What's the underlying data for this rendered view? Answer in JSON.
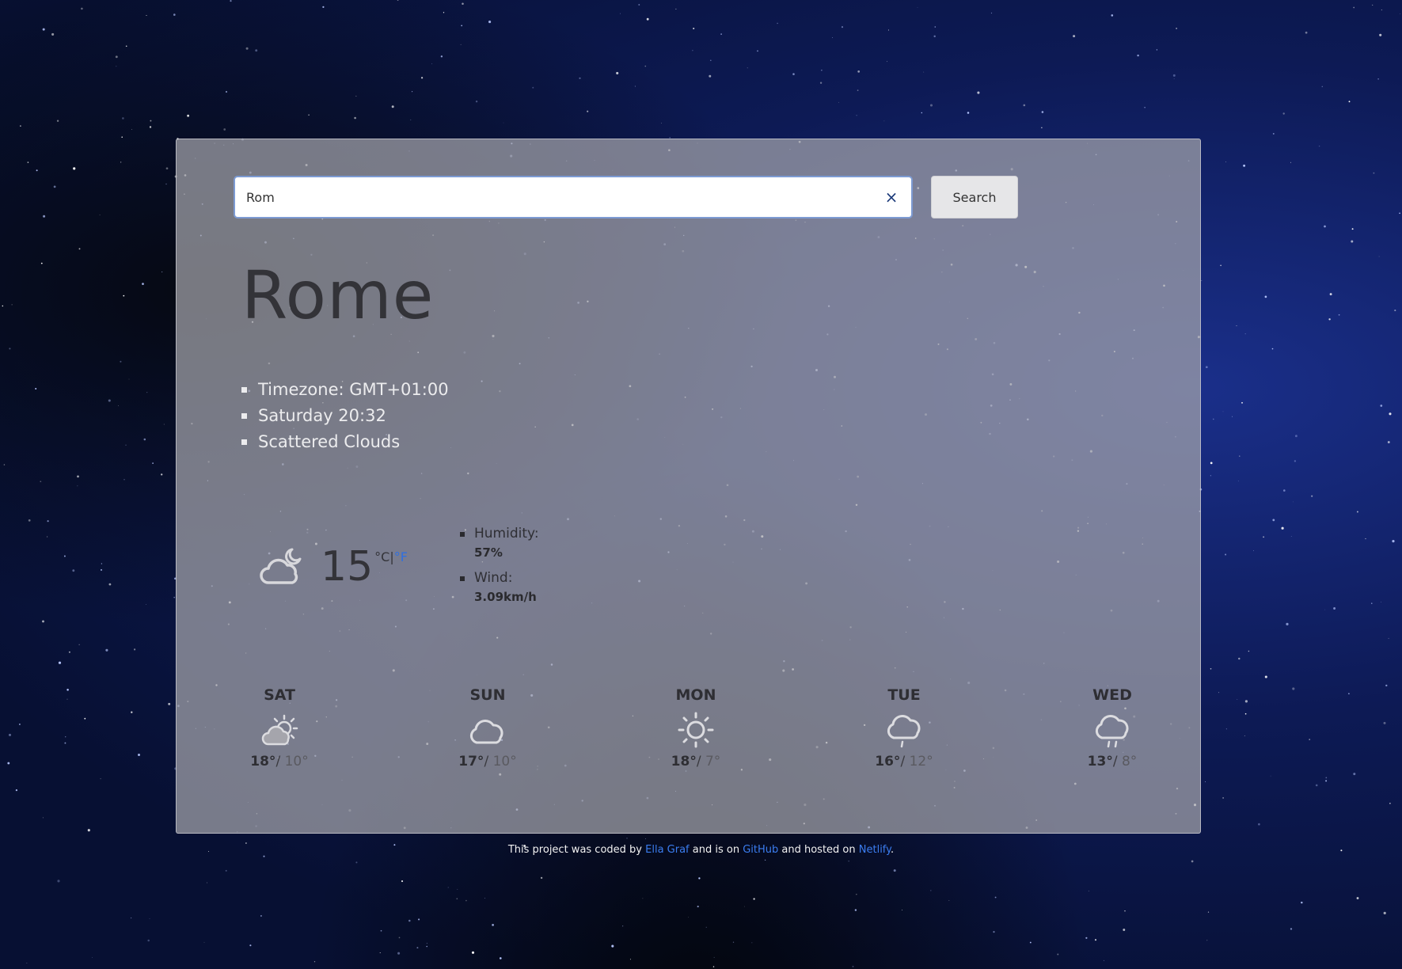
{
  "search": {
    "value": "Rom",
    "clear_symbol": "×",
    "button_label": "Search"
  },
  "city": "Rome",
  "info": {
    "timezone": "Timezone: GMT+01:00",
    "datetime": "Saturday 20:32",
    "description": "Scattered Clouds"
  },
  "current": {
    "icon": "partly-cloudy-night-icon",
    "temperature": "15",
    "unit_c": "°C",
    "unit_sep": "|",
    "unit_f": "°F",
    "humidity_label": "Humidity:",
    "humidity_value": "57%",
    "wind_label": "Wind:",
    "wind_value": "3.09km/h"
  },
  "forecast": [
    {
      "day": "SAT",
      "icon": "partly-cloudy-icon",
      "max": "18°",
      "sep": "/",
      "min": "10°"
    },
    {
      "day": "SUN",
      "icon": "cloud-icon",
      "max": "17°",
      "sep": "/",
      "min": "10°"
    },
    {
      "day": "MON",
      "icon": "sun-icon",
      "max": "18°",
      "sep": "/",
      "min": "7°"
    },
    {
      "day": "TUE",
      "icon": "light-rain-icon",
      "max": "16°",
      "sep": "/",
      "min": "12°"
    },
    {
      "day": "WED",
      "icon": "light-rain-icon",
      "max": "13°",
      "sep": "/",
      "min": "8°"
    }
  ],
  "footer": {
    "text1": "This project was coded by ",
    "author": "Ella Graf",
    "text2": " and is on ",
    "github": "GitHub",
    "text3": " and hosted on ",
    "host": "Netlify",
    "text4": "."
  },
  "colors": {
    "accent_link": "#3b7df0",
    "card_bg": "#a5a5ac"
  }
}
